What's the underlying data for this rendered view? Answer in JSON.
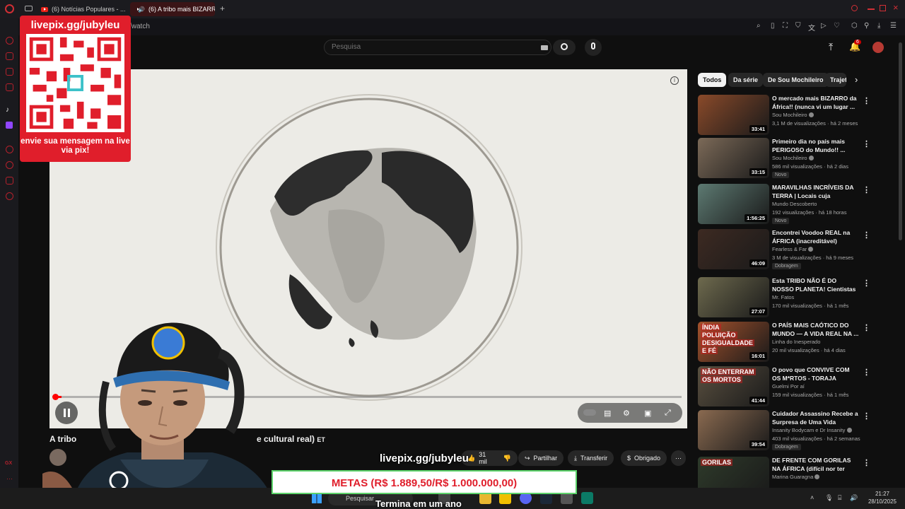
{
  "browser": {
    "tabs": [
      {
        "label": "(6) Notícias Populares - ..."
      },
      {
        "label": "(6) A tribo mais BIZARR..."
      }
    ],
    "new_tab_label": "+",
    "url": "/watch"
  },
  "header": {
    "search_placeholder": "Pesquisa",
    "notification_count": "6"
  },
  "video": {
    "title_visible_start": "A tribo",
    "title_visible_end": "e cultural real)",
    "title_tag": "ET",
    "progress_fraction": 0.01,
    "actions": {
      "likes": "31 mil",
      "share": "Partilhar",
      "download": "Transferir",
      "thanks": "Obrigado",
      "more": "⋯"
    }
  },
  "chips": [
    "Todos",
    "Da série",
    "De Sou Mochileiro",
    "Trajet"
  ],
  "recommendations": [
    {
      "title": "O mercado mais BIZARRO da África!! (nunca vi um lugar ...",
      "channel": "Sou Mochileiro",
      "verified": true,
      "meta": "3,1 M de visualizações · há 2 meses",
      "duration": "33:41",
      "badge": "",
      "thumb_color": "#8a4a2a"
    },
    {
      "title": "Primeiro dia no país mais PERIGOSO do Mundo!! ...",
      "channel": "Sou Mochileiro",
      "verified": true,
      "meta": "586 mil visualizações · há 2 dias",
      "duration": "33:15",
      "badge": "Novo",
      "thumb_color": "#7c6a58"
    },
    {
      "title": "MARAVILHAS INCRÍVEIS DA TERRA | Locais cuja existência...",
      "channel": "Mundo Descoberto",
      "verified": false,
      "meta": "192 visualizações · há 18 horas",
      "duration": "1:56:25",
      "badge": "Novo",
      "thumb_color": "#5d7a72"
    },
    {
      "title": "Encontrei Voodoo REAL na ÁFRICA (inacreditável)",
      "channel": "Fearless & Far",
      "verified": true,
      "meta": "3 M de visualizações · há 9 meses",
      "duration": "46:09",
      "badge": "Dobragem",
      "thumb_color": "#3d2a22"
    },
    {
      "title": "Esta TRIBO NÃO É DO NOSSO PLANETA! Cientistas estão ...",
      "channel": "Mr. Fatos",
      "verified": false,
      "meta": "170 mil visualizações · há 1 mês",
      "duration": "27:07",
      "badge": "",
      "thumb_color": "#6e6a4e"
    },
    {
      "title": "O PAÍS MAIS CAÓTICO DO MUNDO — A VIDA REAL NA ...",
      "channel": "Linha do Inesperado",
      "verified": false,
      "meta": "20 mil visualizações · há 4 dias",
      "duration": "16:01",
      "badge": "",
      "thumb_color": "#a5522c",
      "thumb_text": [
        "ÍNDIA",
        "POLUIÇÃO",
        "DESIGUALDADE",
        "E FÉ"
      ]
    },
    {
      "title": "O povo que CONVIVE COM OS M*RTOS - TORAJA",
      "channel": "Guelmi Por aí",
      "verified": false,
      "meta": "159 mil visualizações · há 1 mês",
      "duration": "41:44",
      "badge": "",
      "thumb_color": "#5a5040",
      "thumb_text": [
        "NÃO ENTERRAM",
        "OS MORTOS"
      ]
    },
    {
      "title": "Cuidador Assassino Recebe a Surpresa de Uma Vida",
      "channel": "Insanity Bodycam",
      "channel2": "e Dr Insanity",
      "verified": true,
      "meta": "403 mil visualizações · há 2 semanas",
      "duration": "39:54",
      "badge": "Dobragem",
      "thumb_color": "#8a6a50"
    },
    {
      "title": "DE FRENTE COM GORILAS NA ÁFRICA (difícil nor ter medo)",
      "channel": "Marina Guaragna",
      "verified": true,
      "meta": "",
      "duration": "",
      "badge": "",
      "thumb_color": "#2e3a2a",
      "thumb_text": [
        "GORILAS"
      ]
    }
  ],
  "overlay": {
    "qr_url": "livepix.gg/jubyleu",
    "qr_message": "envie sua mensagem na live via pix!",
    "live_url": "livepix.gg/jubyleu",
    "goal": "METAS (R$ 1.889,50/R$ 1.000.000,00)",
    "goal_sub": "Termina em um ano",
    "corner_label": "GX"
  },
  "taskbar": {
    "search_label": "Pesquisar",
    "time": "21:27",
    "date": "28/10/2025"
  },
  "colors": {
    "youtube_red": "#ff0000",
    "livepix_red": "#e01e2b",
    "goal_border": "#5dd36b",
    "background": "#0f0f0f"
  }
}
